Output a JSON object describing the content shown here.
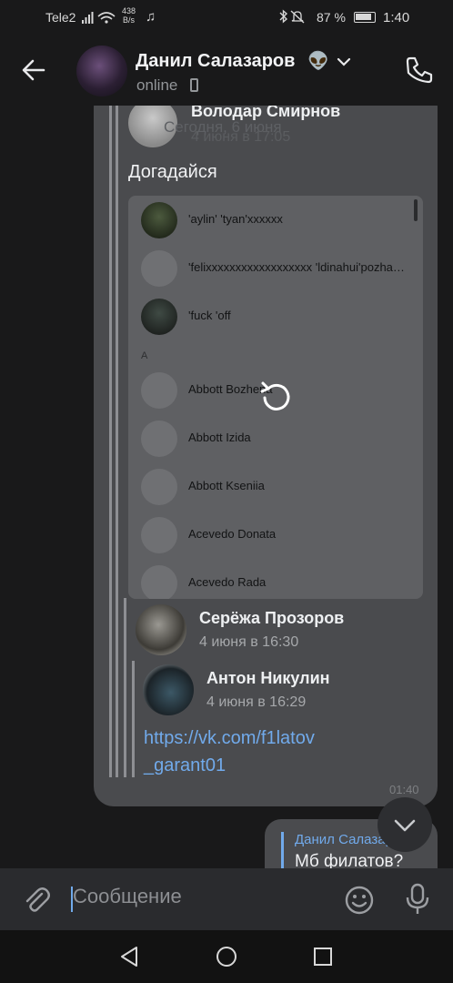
{
  "status_bar": {
    "carrier": "Tele2",
    "speed_value": "438",
    "speed_unit": "B/s",
    "battery_pct": "87 %",
    "battery_level": 0.87,
    "time": "1:40",
    "icons": [
      "signal-icon",
      "wifi-icon",
      "music-icon",
      "bluetooth-icon",
      "mute-icon",
      "battery-icon"
    ]
  },
  "header": {
    "name": "Данил Салазаров",
    "emoji": "👽",
    "status": "online"
  },
  "forwarded": {
    "top": {
      "name": "Володар Смирнов",
      "date_overlay": "Сегодня, 6 июня",
      "date": "4 июня в 17:05"
    },
    "message_text": "Догадайся",
    "attachment_contacts": [
      {
        "name": "'aylin' 'tyan'xxxxxx",
        "avatar": "photo"
      },
      {
        "name": "'felixxxxxxxxxxxxxxxxxx 'ldinahui'pozha…",
        "avatar": "default"
      },
      {
        "name": "'fuck 'off",
        "avatar": "photo"
      },
      {
        "section": "A"
      },
      {
        "name": "Abbott Bozhena",
        "avatar": "default"
      },
      {
        "name": "Abbott Izida",
        "avatar": "default"
      },
      {
        "name": "Abbott Kseniia",
        "avatar": "default"
      },
      {
        "name": "Acevedo Donata",
        "avatar": "default"
      },
      {
        "name": "Acevedo Rada",
        "avatar": "default"
      }
    ],
    "second": {
      "name": "Серёжа Прозоров",
      "date": "4 июня в 16:30"
    },
    "third": {
      "name": "Антон Никулин",
      "date": "4 июня в 16:29"
    },
    "link_line1": "https://vk.com/f1latov",
    "link_line2": "_garant01"
  },
  "message_time": "01:40",
  "own_message": {
    "reply_name": "Данил Салазаров",
    "text": "Мб филатов?"
  },
  "composer": {
    "placeholder": "Сообщение"
  }
}
